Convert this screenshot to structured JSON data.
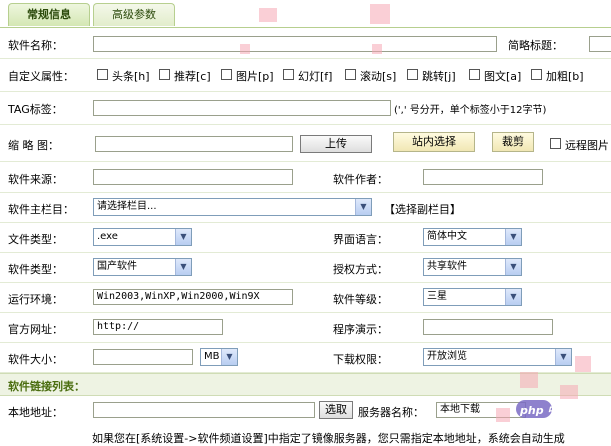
{
  "tabs": [
    {
      "label": "常规信息",
      "active": true
    },
    {
      "label": "高级参数",
      "active": false
    }
  ],
  "software_name": {
    "label": "软件名称：",
    "value": ""
  },
  "short_title": {
    "label": "简略标题：",
    "value": ""
  },
  "custom_attrs": {
    "label": "自定义属性：",
    "items": [
      "头条[h]",
      "推荐[c]",
      "图片[p]",
      "幻灯[f]",
      "滚动[s]",
      "跳转[j]",
      "图文[a]",
      "加粗[b]"
    ]
  },
  "tags": {
    "label": "TAG标签：",
    "value": "",
    "hint": "(',' 号分开，单个标签小于12字节)"
  },
  "thumb": {
    "label": "缩 略 图：",
    "upload_label": "上传",
    "site_select_label": "站内选择",
    "crop_label": "裁剪",
    "remote_label": "远程图片"
  },
  "source": {
    "label": "软件来源：",
    "value": ""
  },
  "author": {
    "label": "软件作者：",
    "value": ""
  },
  "main_column": {
    "label": "软件主栏目：",
    "selected": "请选择栏目...",
    "sub_link": "【选择副栏目】"
  },
  "file_type": {
    "label": "文件类型：",
    "selected": ".exe"
  },
  "ui_lang": {
    "label": "界面语言：",
    "selected": "简体中文"
  },
  "soft_type": {
    "label": "软件类型：",
    "selected": "国产软件"
  },
  "license": {
    "label": "授权方式：",
    "selected": "共享软件"
  },
  "runtime": {
    "label": "运行环境：",
    "value": "Win2003,WinXP,Win2000,Win9X"
  },
  "rank": {
    "label": "软件等级：",
    "selected": "三星"
  },
  "website": {
    "label": "官方网址：",
    "value": "http://"
  },
  "demo": {
    "label": "程序演示：",
    "value": ""
  },
  "size": {
    "label": "软件大小：",
    "value": "",
    "unit": "MB"
  },
  "download_perm": {
    "label": "下载权限：",
    "selected": "开放浏览"
  },
  "link_section": {
    "title": "软件链接列表："
  },
  "local_addr": {
    "label": "本地地址：",
    "value": "",
    "choose_label": "选取"
  },
  "server_name": {
    "label": "服务器名称：",
    "value": "本地下载"
  },
  "note": {
    "text": "如果您在[系统设置->软件频道设置]中指定了镜像服务器，您只需指定本地地址，系统会自动生成"
  },
  "watermark": {
    "text": "php 中文网"
  }
}
